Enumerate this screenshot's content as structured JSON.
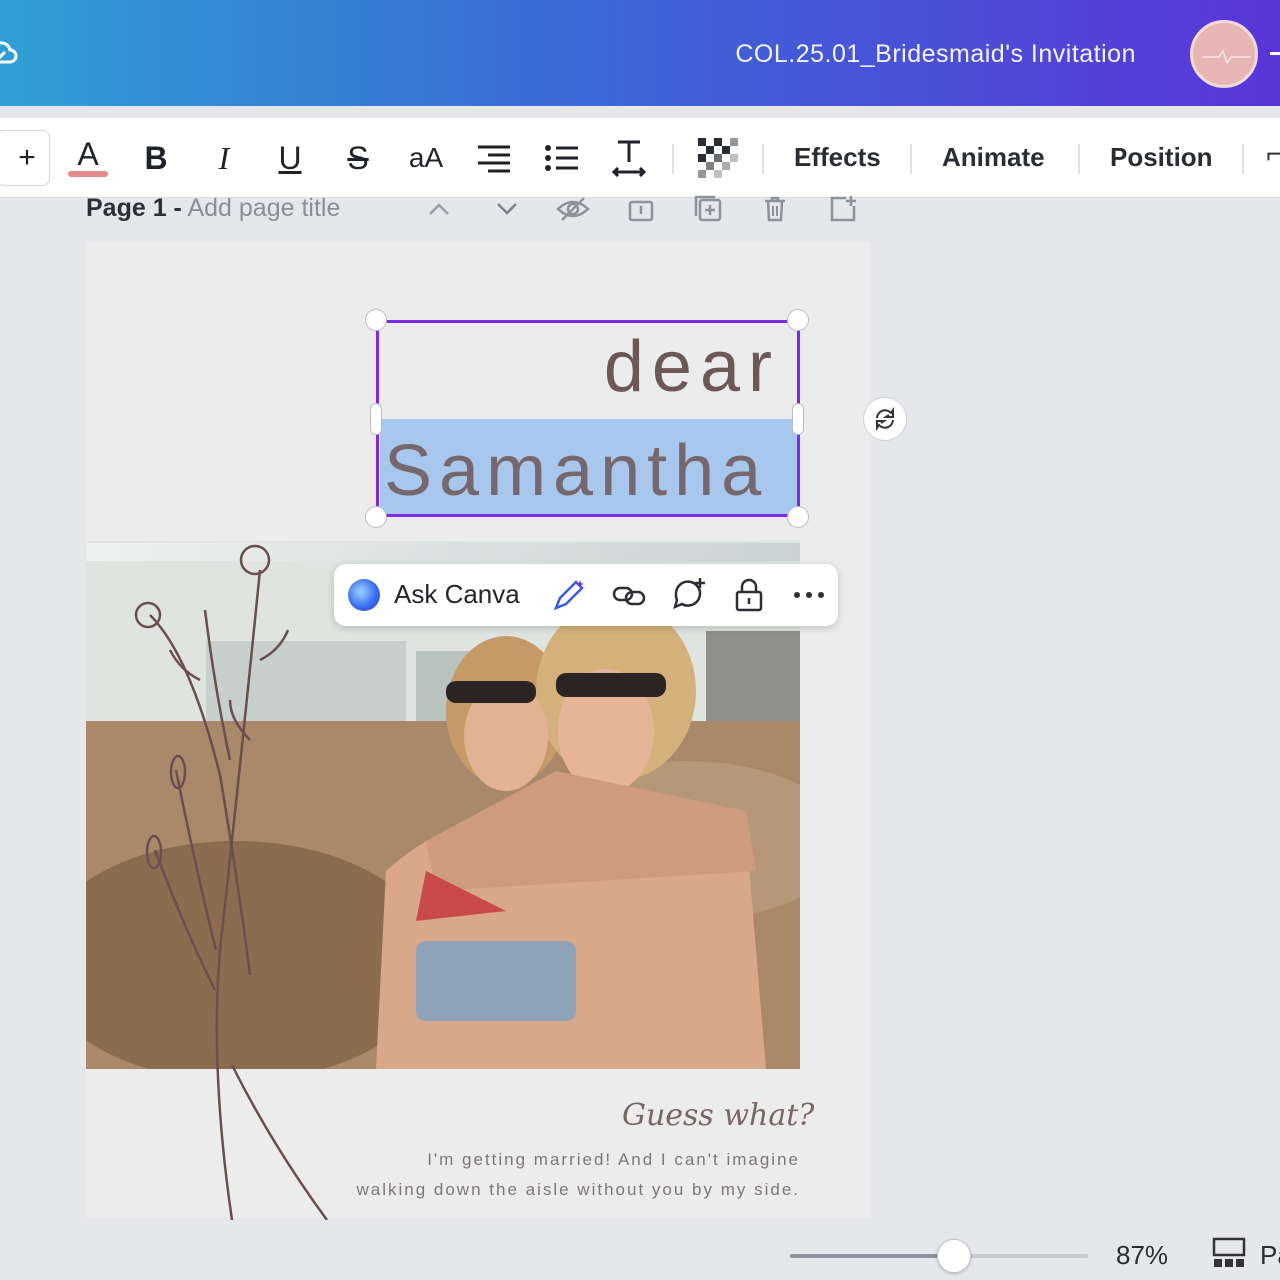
{
  "header": {
    "doc_title": "COL.25.01_Bridesmaid's Invitation"
  },
  "toolbar": {
    "plus": "+",
    "color_glyph": "A",
    "bold_glyph": "B",
    "italic_glyph": "I",
    "underline_glyph": "U",
    "strike_glyph": "S",
    "case_glyph": "aA",
    "effects": "Effects",
    "animate": "Animate",
    "position": "Position",
    "text_color": "#e38b8b"
  },
  "pagebar": {
    "page_prefix": "Page 1 -",
    "page_title_placeholder": "Add page title"
  },
  "design": {
    "line1": "dear",
    "line2": "Samantha",
    "script_line": "Guess what?",
    "message_line1": "I'm getting married! And I can't imagine",
    "message_line2": "walking down the aisle without you by my side.",
    "text_color": "#6e5757",
    "selection_color": "#7d2ae8"
  },
  "float_toolbar": {
    "ask_label": "Ask Canva"
  },
  "zoom": {
    "percent_label": "87%",
    "level": 0.55,
    "pages_label": "Pa"
  }
}
